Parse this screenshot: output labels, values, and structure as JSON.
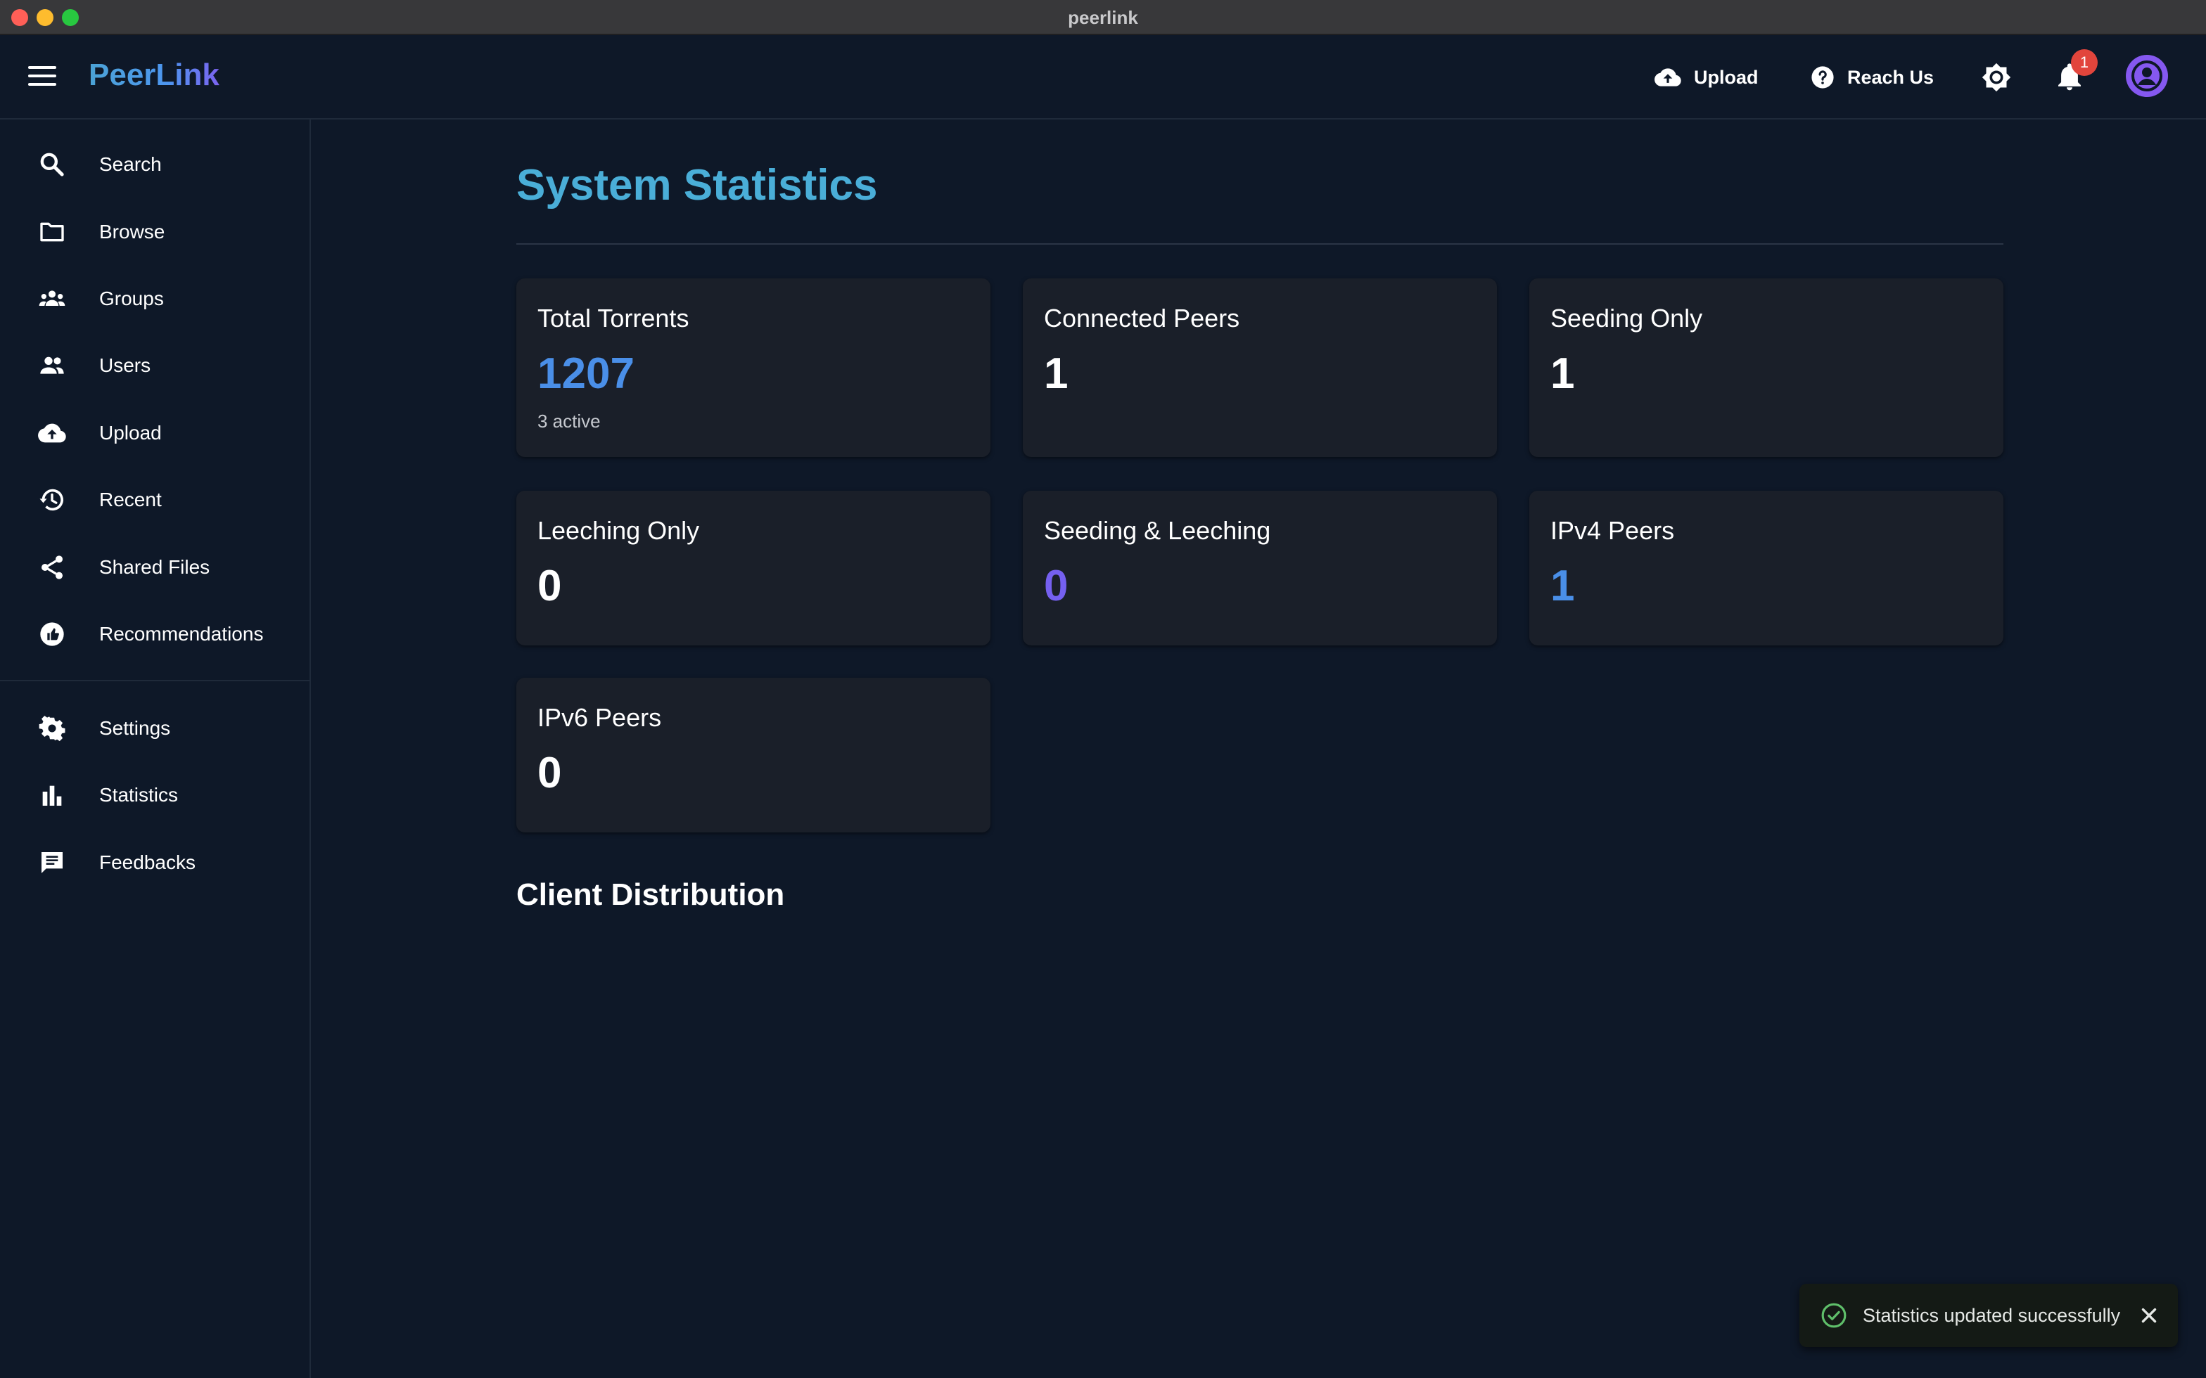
{
  "window": {
    "title": "peerlink"
  },
  "header": {
    "brand": "PeerLink",
    "upload_label": "Upload",
    "reach_label": "Reach Us",
    "notification_count": "1",
    "icons": [
      "menu-icon",
      "cloud-upload-icon",
      "help-icon",
      "brightness-icon",
      "bell-icon",
      "account-icon"
    ]
  },
  "sidebar": {
    "items": [
      {
        "label": "Search",
        "icon": "search-icon"
      },
      {
        "label": "Browse",
        "icon": "folder-icon"
      },
      {
        "label": "Groups",
        "icon": "groups-icon"
      },
      {
        "label": "Users",
        "icon": "users-icon"
      },
      {
        "label": "Upload",
        "icon": "cloud-upload-icon"
      },
      {
        "label": "Recent",
        "icon": "history-icon"
      },
      {
        "label": "Shared Files",
        "icon": "share-icon"
      },
      {
        "label": "Recommendations",
        "icon": "recommend-icon"
      }
    ],
    "secondary": [
      {
        "label": "Settings",
        "icon": "gear-icon"
      },
      {
        "label": "Statistics",
        "icon": "bar-chart-icon"
      },
      {
        "label": "Feedbacks",
        "icon": "feedback-icon"
      }
    ]
  },
  "main": {
    "title": "System Statistics",
    "cards": [
      {
        "label": "Total Torrents",
        "value": "1207",
        "sub": "3 active",
        "color": "#4a8fe8"
      },
      {
        "label": "Connected Peers",
        "value": "1",
        "sub": "",
        "color": "#ffffff"
      },
      {
        "label": "Seeding Only",
        "value": "1",
        "sub": "",
        "color": "#ffffff"
      },
      {
        "label": "Leeching Only",
        "value": "0",
        "sub": "",
        "color": "#ffffff"
      },
      {
        "label": "Seeding & Leeching",
        "value": "0",
        "sub": "",
        "color": "#7560f0"
      },
      {
        "label": "IPv4 Peers",
        "value": "1",
        "sub": "",
        "color": "#4a8fe8"
      },
      {
        "label": "IPv6 Peers",
        "value": "0",
        "sub": "",
        "color": "#ffffff"
      }
    ],
    "section_title": "Client Distribution"
  },
  "toast": {
    "message": "Statistics updated successfully",
    "icon": "check-circle-icon",
    "close_icon": "close-icon"
  },
  "colors": {
    "background": "#0e1828",
    "card": "#1a1f29",
    "accent": "#4aaed8",
    "blue": "#4a8fe8",
    "purple": "#7560f0"
  }
}
